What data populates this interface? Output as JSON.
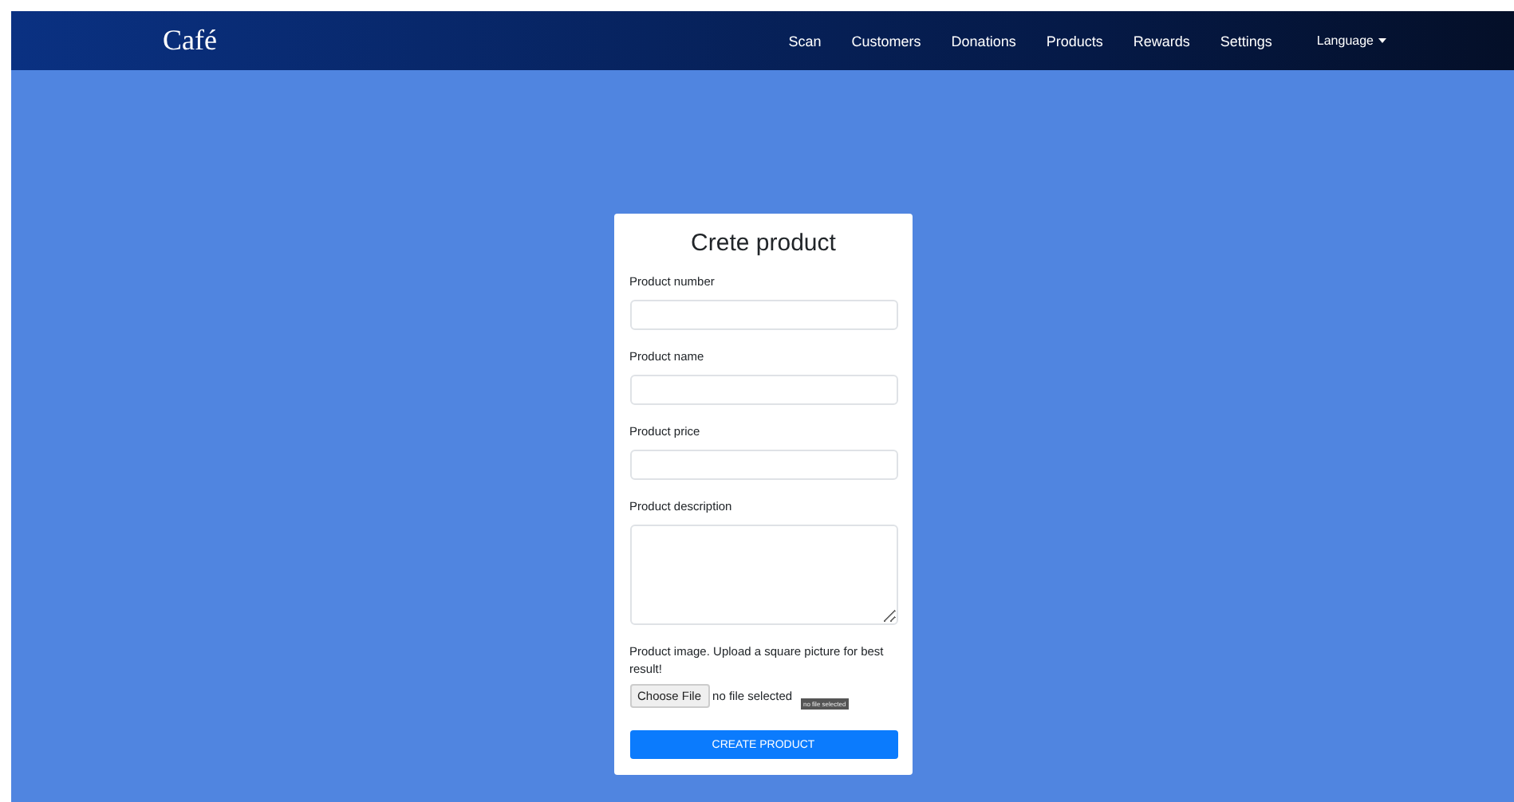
{
  "navbar": {
    "brand": "Café",
    "links": [
      "Scan",
      "Customers",
      "Donations",
      "Products",
      "Rewards",
      "Settings"
    ],
    "language": "Language"
  },
  "form": {
    "title": "Crete product",
    "fields": [
      {
        "kind": "input",
        "label": "Product number"
      },
      {
        "kind": "input",
        "label": "Product name"
      },
      {
        "kind": "input",
        "label": "Product price"
      },
      {
        "kind": "textarea",
        "label": "Product description"
      },
      {
        "kind": "file",
        "label": "Product image. Upload a square picture for best result!",
        "button": "Choose File",
        "status": "no file selected",
        "tooltip": "no file selected"
      }
    ],
    "submit": "CREATE PRODUCT"
  }
}
